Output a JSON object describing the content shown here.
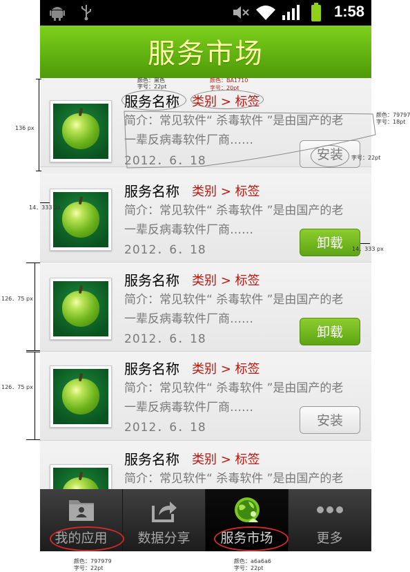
{
  "status_bar": {
    "time": "1:58"
  },
  "header": {
    "title": "服务市场"
  },
  "list": {
    "items": [
      {
        "name": "服务名称",
        "category": "类别 > 标签",
        "desc_line1": "简介：常见软件“ 杀毒软件 ”是由国产的老",
        "desc_line2": "一辈反病毒软件厂商……",
        "date": "2012．6．18",
        "button": "安装",
        "button_type": "install"
      },
      {
        "name": "服务名称",
        "category": "类别 > 标签",
        "desc_line1": "简介：常见软件“ 杀毒软件 ”是由国产的老",
        "desc_line2": "一辈反病毒软件厂商……",
        "date": "2012．6．18",
        "button": "卸载",
        "button_type": "uninstall"
      },
      {
        "name": "服务名称",
        "category": "类别 > 标签",
        "desc_line1": "简介：常见软件“ 杀毒软件 ”是由国产的老",
        "desc_line2": "一辈反病毒软件厂商……",
        "date": "2012．6．18",
        "button": "卸载",
        "button_type": "uninstall"
      },
      {
        "name": "服务名称",
        "category": "类别 > 标签",
        "desc_line1": "简介：常见软件“ 杀毒软件 ”是由国产的老",
        "desc_line2": "一辈反病毒软件厂商……",
        "date": "2012．6．18",
        "button": "安装",
        "button_type": "install"
      },
      {
        "name": "服务名称",
        "category": "类别 > 标签",
        "desc_line1": "简介：常见软件“ 杀毒软件 ”是由国产的老"
      }
    ]
  },
  "tabs": [
    {
      "label": "我的应用",
      "icon": "folder-user-icon"
    },
    {
      "label": "数据分享",
      "icon": "share-icon"
    },
    {
      "label": "服务市场",
      "icon": "globe-user-icon",
      "active": true
    },
    {
      "label": "更多",
      "icon": "more-dots-icon"
    }
  ],
  "annotations": {
    "name_color": "颜色：黑色",
    "name_size": "字号：22pt",
    "cat_color": "颜色：BA1710",
    "cat_size": "字号：20pt",
    "desc_color": "颜色：797979",
    "desc_size": "字号：18pt",
    "btn_size": "字号：22pt",
    "row_height": "136 px",
    "left_margin": "14．333 px",
    "right_margin": "14．333 px",
    "row_height_2": "126．75 px",
    "row_height_3": "126．75 px",
    "tab_color": "颜色：797979",
    "tab_size": "字号：22pt",
    "tab_active_color": "颜色：a6a6a6",
    "tab_active_size": "字号：22pt"
  },
  "colors": {
    "accent_green": "#5fb00f",
    "category_red": "#ba1710",
    "desc_gray": "#797979",
    "tab_gray": "#a6a6a6"
  }
}
